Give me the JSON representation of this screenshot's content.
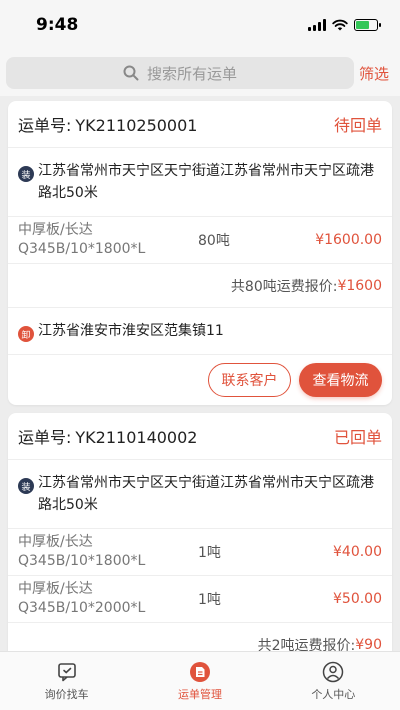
{
  "status_bar": {
    "time": "9:48"
  },
  "search": {
    "placeholder": "搜索所有运单",
    "filter_label": "筛选"
  },
  "orders": [
    {
      "waybill_label": "运单号:",
      "waybill_no": "YK2110250001",
      "status": "待回单",
      "load_badge": "装",
      "load_address": "江苏省常州市天宁区天宁街道江苏省常州市天宁区疏港路北50米",
      "goods": [
        {
          "name_line1": "中厚板/长达",
          "name_line2": "Q345B/10*1800*L",
          "qty": "80吨",
          "price": "¥1600.00"
        }
      ],
      "summary_label": "共80吨运费报价:",
      "summary_amount": "¥1600",
      "unload_badge": "卸",
      "unload_address": "江苏省淮安市淮安区范集镇11",
      "contact_button": "联系客户",
      "logistics_button": "查看物流"
    },
    {
      "waybill_label": "运单号:",
      "waybill_no": "YK2110140002",
      "status": "已回单",
      "load_badge": "装",
      "load_address": "江苏省常州市天宁区天宁街道江苏省常州市天宁区疏港路北50米",
      "goods": [
        {
          "name_line1": "中厚板/长达",
          "name_line2": "Q345B/10*1800*L",
          "qty": "1吨",
          "price": "¥40.00"
        },
        {
          "name_line1": "中厚板/长达",
          "name_line2": "Q345B/10*2000*L",
          "qty": "1吨",
          "price": "¥50.00"
        }
      ],
      "summary_label": "共2吨运费报价:",
      "summary_amount": "¥90"
    }
  ],
  "tabbar": {
    "items": [
      {
        "label": "询价找车",
        "icon": "message-icon",
        "active": false
      },
      {
        "label": "运单管理",
        "icon": "document-icon",
        "active": true
      },
      {
        "label": "个人中心",
        "icon": "user-icon",
        "active": false
      }
    ]
  },
  "colors": {
    "accent": "#e0533c",
    "load_badge": "#2d3a55"
  }
}
